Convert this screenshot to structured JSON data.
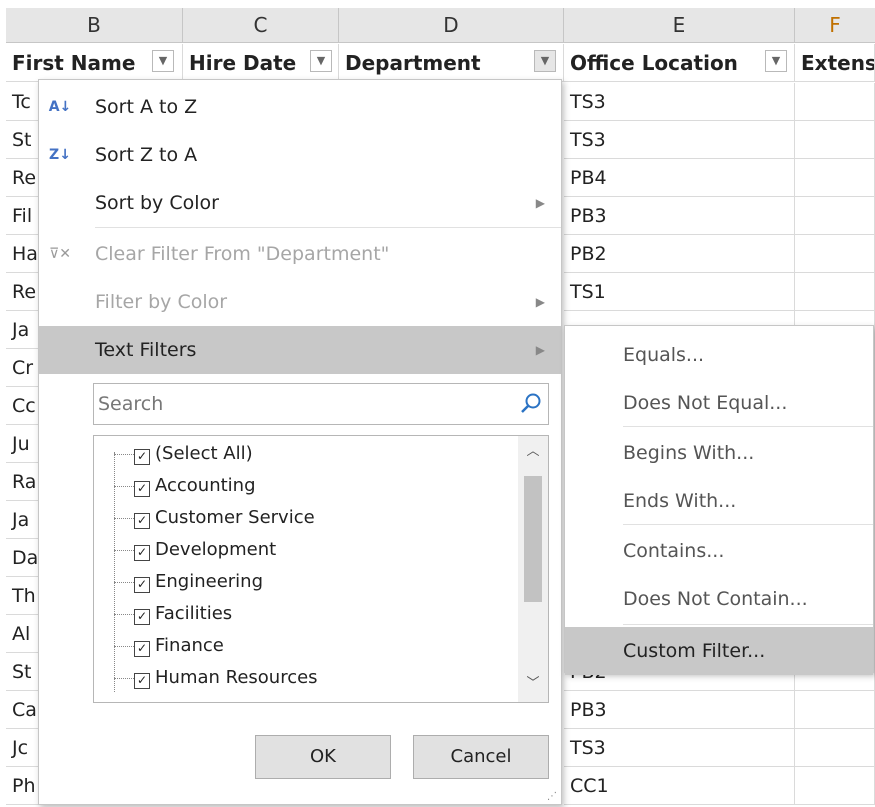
{
  "col_headers": [
    "B",
    "C",
    "D",
    "E",
    "F"
  ],
  "field_headers": [
    "First Name",
    "Hire Date",
    "Department",
    "Office Location",
    "Extens"
  ],
  "col_b_values": [
    "Tc",
    "St",
    "Re",
    "Fil",
    "Ha",
    "Re",
    "Ja",
    "Cr",
    "Cc",
    "Ju",
    "Ra",
    "Ja",
    "Da",
    "Th",
    "Al",
    "St",
    "Ca",
    "Jc",
    "Ph"
  ],
  "col_e_values": [
    "TS3",
    "TS3",
    "PB4",
    "PB3",
    "PB2",
    "TS1",
    "",
    "",
    "",
    "",
    "",
    "",
    "",
    "",
    "",
    "PB2",
    "PB3",
    "TS3",
    "CC1"
  ],
  "menu": {
    "sort_az": "Sort A to Z",
    "sort_za": "Sort Z to A",
    "sort_color": "Sort by Color",
    "clear_filter": "Clear Filter From \"Department\"",
    "filter_color": "Filter by Color",
    "text_filters": "Text Filters",
    "search_placeholder": "Search",
    "ok": "OK",
    "cancel": "Cancel"
  },
  "filter_items": [
    "(Select All)",
    "Accounting",
    "Customer Service",
    "Development",
    "Engineering",
    "Facilities",
    "Finance",
    "Human Resources"
  ],
  "submenu": [
    "Equals...",
    "Does Not Equal...",
    "Begins With...",
    "Ends With...",
    "Contains...",
    "Does Not Contain...",
    "Custom Filter..."
  ],
  "icons": {
    "sort_az": "sort-ascending-icon",
    "sort_za": "sort-descending-icon",
    "clear": "clear-filter-icon",
    "search": "search-icon",
    "dropdown": "filter-dropdown-icon"
  },
  "colors": {
    "highlight": "#c8c8c8",
    "header_bg": "#e6e6e6"
  }
}
